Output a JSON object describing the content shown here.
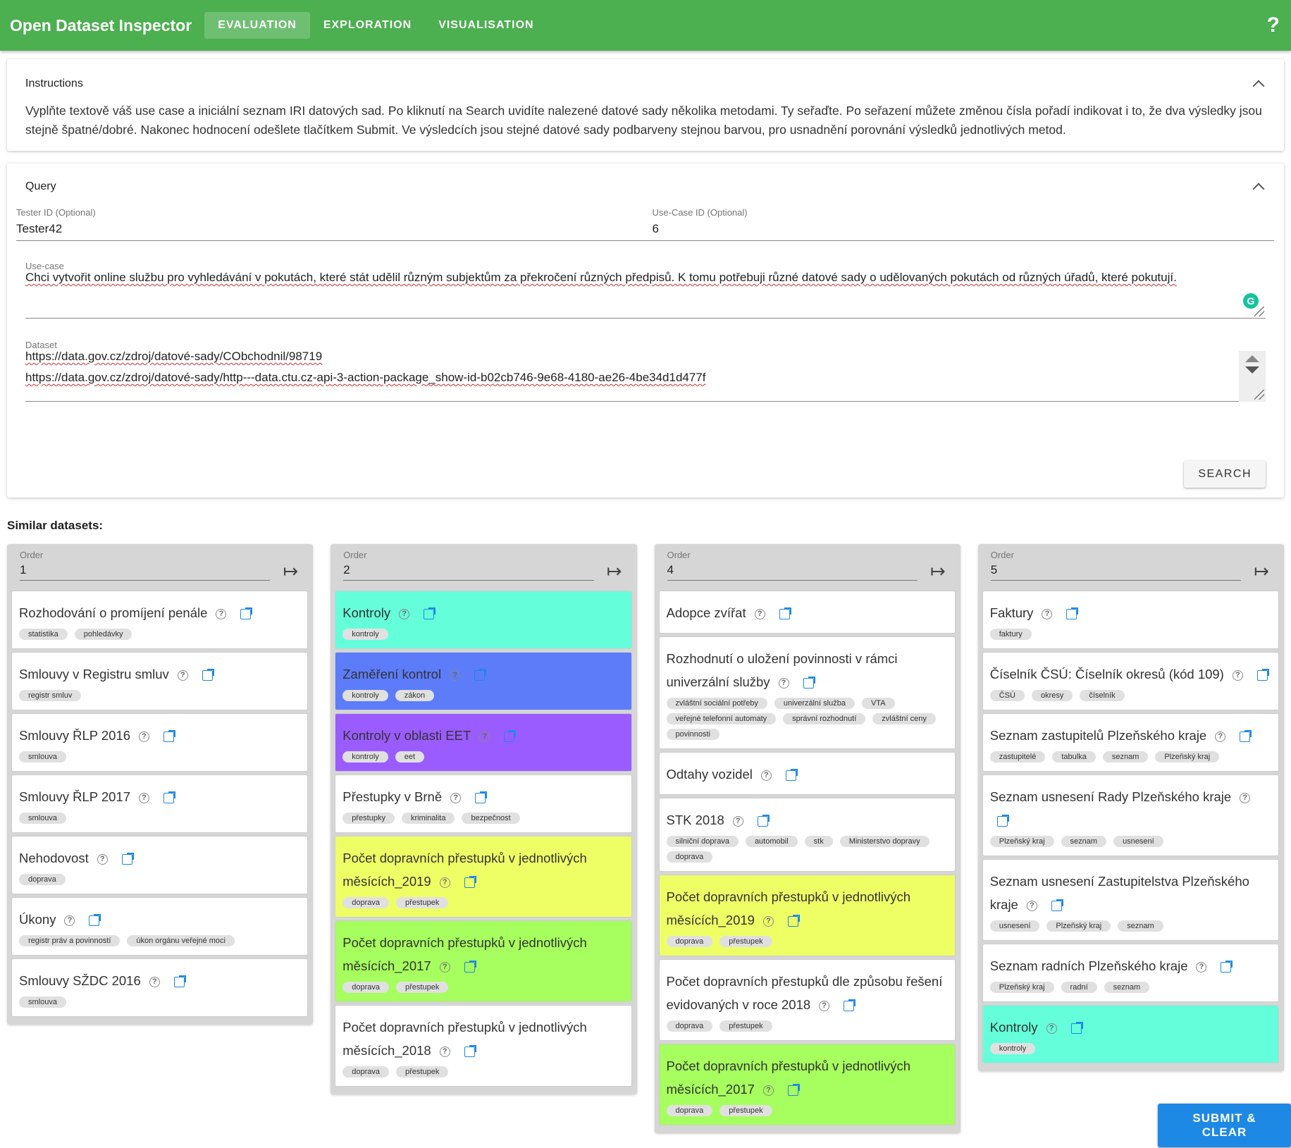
{
  "app": {
    "title": "Open Dataset Inspector",
    "tabs": [
      "EVALUATION",
      "EXPLORATION",
      "VISUALISATION"
    ],
    "help": "?"
  },
  "instructions": {
    "title": "Instructions",
    "text": "Vyplňte textově váš use case a iniciální seznam IRI datových sad. Po kliknutí na Search uvidíte nalezené datové sady několika metodami. Ty seřaďte. Po seřazení můžete změnou čísla pořadí indikovat i to, že dva výsledky jsou stejně špatné/dobré. Nakonec hodnocení odešlete tlačítkem Submit. Ve výsledcích jsou stejné datové sady podbarveny stejnou barvou, pro usnadnění porovnání výsledků jednotlivých metod."
  },
  "query": {
    "title": "Query",
    "tester_label": "Tester ID (Optional)",
    "tester_value": "Tester42",
    "usecase_id_label": "Use-Case ID (Optional)",
    "usecase_id_value": "6",
    "usecase_label": "Use-case",
    "usecase_value": "Chci vytvořit online službu pro vyhledávání v pokutách, které stát udělil různým subjektům za překročení různých předpisů. K tomu potřebuji různé datové sady o udělovaných pokutách od různých úřadů, které pokutují.",
    "dataset_label": "Dataset",
    "dataset_lines": [
      "https://data.gov.cz/zdroj/datové-sady/CObchodnil/98719",
      "https://data.gov.cz/zdroj/datové-sady/http---data.ctu.cz-api-3-action-package_show-id-b02cb746-9e68-4180-ae26-4be34d1d477f"
    ],
    "search_label": "SEARCH"
  },
  "similar_title": "Similar datasets:",
  "order_label": "Order",
  "submit_label": "SUBMIT & CLEAR",
  "columns": [
    {
      "order": "1",
      "cards": [
        {
          "title": "Rozhodování o promíjení penále",
          "tags": [
            "statistika",
            "pohledávky"
          ],
          "color": "white"
        },
        {
          "title": "Smlouvy v Registru smluv",
          "tags": [
            "registr smluv"
          ],
          "color": "white"
        },
        {
          "title": "Smlouvy ŘLP 2016",
          "tags": [
            "smlouva"
          ],
          "color": "white"
        },
        {
          "title": "Smlouvy ŘLP 2017",
          "tags": [
            "smlouva"
          ],
          "color": "white"
        },
        {
          "title": "Nehodovost",
          "tags": [
            "doprava"
          ],
          "color": "white"
        },
        {
          "title": "Úkony",
          "tags": [
            "registr práv a povinností",
            "úkon orgánu veřejné moci"
          ],
          "color": "white"
        },
        {
          "title": "Smlouvy SŽDC 2016",
          "tags": [
            "smlouva"
          ],
          "color": "white"
        }
      ]
    },
    {
      "order": "2",
      "cards": [
        {
          "title": "Kontroly",
          "tags": [
            "kontroly"
          ],
          "color": "teal"
        },
        {
          "title": "Zaměření kontrol",
          "tags": [
            "kontroly",
            "zákon"
          ],
          "color": "blue"
        },
        {
          "title": "Kontroly v oblasti EET",
          "tags": [
            "kontroly",
            "eet"
          ],
          "color": "purple"
        },
        {
          "title": "Přestupky v Brně",
          "tags": [
            "přestupky",
            "kriminalita",
            "bezpečnost"
          ],
          "color": "white"
        },
        {
          "title": "Počet dopravních přestupků v jednotlivých měsících_2019",
          "tags": [
            "doprava",
            "přestupek"
          ],
          "color": "yellow"
        },
        {
          "title": "Počet dopravních přestupků v jednotlivých měsících_2017",
          "tags": [
            "doprava",
            "přestupek"
          ],
          "color": "green"
        },
        {
          "title": "Počet dopravních přestupků v jednotlivých měsících_2018",
          "tags": [
            "doprava",
            "přestupek"
          ],
          "color": "white"
        }
      ]
    },
    {
      "order": "4",
      "cards": [
        {
          "title": "Adopce zvířat",
          "tags": [],
          "color": "white"
        },
        {
          "title": "Rozhodnutí o uložení povinnosti v rámci univerzální služby",
          "tags": [
            "zvláštní sociální potřeby",
            "univerzální služba",
            "VTA",
            "veřejné telefonní automaty",
            "správní rozhodnutí",
            "zvláštní ceny",
            "povinnosti"
          ],
          "color": "white"
        },
        {
          "title": "Odtahy vozidel",
          "tags": [],
          "color": "white"
        },
        {
          "title": "STK 2018",
          "tags": [
            "silniční doprava",
            "automobil",
            "stk",
            "Ministerstvo dopravy",
            "doprava"
          ],
          "color": "white"
        },
        {
          "title": "Počet dopravních přestupků v jednotlivých měsících_2019",
          "tags": [
            "doprava",
            "přestupek"
          ],
          "color": "yellow"
        },
        {
          "title": "Počet dopravních přestupků dle způsobu řešení evidovaných v roce 2018",
          "tags": [
            "doprava",
            "přestupek"
          ],
          "color": "white"
        },
        {
          "title": "Počet dopravních přestupků v jednotlivých měsících_2017",
          "tags": [
            "doprava",
            "přestupek"
          ],
          "color": "green"
        }
      ]
    },
    {
      "order": "5",
      "cards": [
        {
          "title": "Faktury",
          "tags": [
            "faktury"
          ],
          "color": "white"
        },
        {
          "title": "Číselník ČSÚ: Číselník okresů (kód 109)",
          "tags": [
            "ČSÚ",
            "okresy",
            "číselník"
          ],
          "color": "white"
        },
        {
          "title": "Seznam zastupitelů Plzeňského kraje",
          "tags": [
            "zastupitelé",
            "tabulka",
            "seznam",
            "Plzeňský kraj"
          ],
          "color": "white"
        },
        {
          "title": "Seznam usnesení Rady Plzeňského kraje",
          "tags": [
            "Plzeňský kraj",
            "seznam",
            "usnesení"
          ],
          "color": "white"
        },
        {
          "title": "Seznam usnesení Zastupitelstva Plzeňského kraje",
          "tags": [
            "usnesení",
            "Plzeňský kraj",
            "seznam"
          ],
          "color": "white"
        },
        {
          "title": "Seznam radních Plzeňského kraje",
          "tags": [
            "Plzeňský kraj",
            "radní",
            "seznam"
          ],
          "color": "white"
        },
        {
          "title": "Kontroly",
          "tags": [
            "kontroly"
          ],
          "color": "teal"
        }
      ]
    }
  ]
}
